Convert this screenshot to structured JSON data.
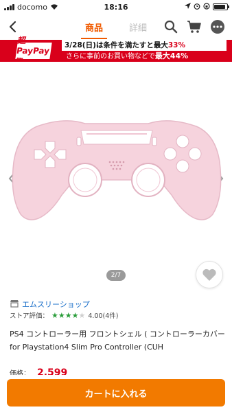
{
  "status": {
    "carrier": "docomo",
    "time": "18:16",
    "battery_level": 0.9
  },
  "nav": {
    "tabs": [
      {
        "label": "商品",
        "active": true
      },
      {
        "label": "詳細",
        "active": false
      }
    ],
    "icons": [
      "back-chevron-icon",
      "search-icon",
      "cart-icon",
      "more-icon"
    ]
  },
  "banner": {
    "logo": "超PayPay祭",
    "line1_prefix": "3/28",
    "line1_day": "(日)",
    "line1_mid": "は条件を満たすと最大",
    "line1_pct": "33%",
    "line2_text": "さらに事前のお買い物などで",
    "line2_pct": "最大44%"
  },
  "gallery": {
    "indicator": "2/7",
    "current": 2,
    "total": 7
  },
  "store": {
    "name": "エムスリーショップ",
    "rating_label": "ストア評価：",
    "rating_value": "4.00(4件)",
    "stars": 4
  },
  "product": {
    "title": "PS4 コントローラー用 フロントシェル ( コントローラーカバー for Playstation4 Slim Pro Controller (CUH",
    "price_label": "価格：",
    "price": "2,599"
  },
  "cart": {
    "button_label": "カートに入れる"
  },
  "colors": {
    "accent": "#f05a00",
    "cart": "#f27a00",
    "banner_red": "#d9001b",
    "shell_pink": "#f6d3dd",
    "link_blue": "#1a6fc9",
    "star_green": "#2a9d3a"
  }
}
